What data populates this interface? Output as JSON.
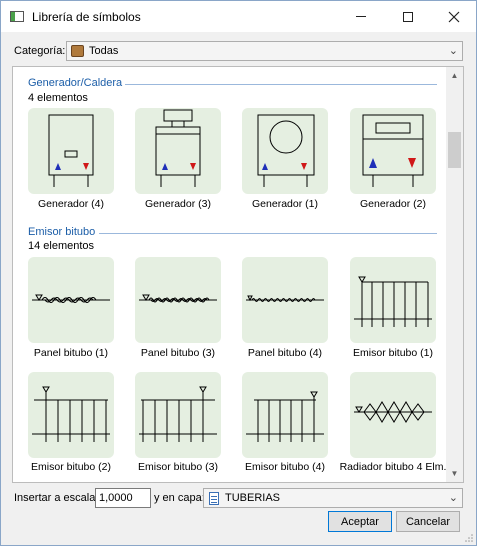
{
  "window": {
    "title": "Librería de símbolos"
  },
  "category": {
    "label": "Categoría:",
    "value": "Todas"
  },
  "sections": [
    {
      "title": "Generador/Caldera",
      "count": "4 elementos",
      "items": [
        {
          "label": "Generador (4)"
        },
        {
          "label": "Generador (3)"
        },
        {
          "label": "Generador (1)"
        },
        {
          "label": "Generador (2)"
        }
      ]
    },
    {
      "title": "Emisor bitubo",
      "count": "14 elementos",
      "items": [
        {
          "label": "Panel bitubo (1)"
        },
        {
          "label": "Panel bitubo (3)"
        },
        {
          "label": "Panel bitubo (4)"
        },
        {
          "label": "Emisor bitubo (1)"
        },
        {
          "label": "Emisor bitubo (2)"
        },
        {
          "label": "Emisor bitubo (3)"
        },
        {
          "label": "Emisor bitubo (4)"
        },
        {
          "label": "Radiador bitubo 4 Elm."
        }
      ]
    }
  ],
  "bottom": {
    "scale_label": "Insertar a escala:",
    "scale_value": "1,0000",
    "layer_label": "y en capa:",
    "layer_value": "TUBERIAS"
  },
  "buttons": {
    "accept": "Aceptar",
    "cancel": "Cancelar"
  },
  "colors": {
    "tile_bg": "#e5efe1",
    "section_title": "#1c5ea8",
    "arrow_blue": "#1f2fb8",
    "arrow_red": "#d01818"
  },
  "icons": {
    "app": "window-icon",
    "category": "box-icon",
    "layer": "layer-document-icon",
    "dropdown": "chevron-down-icon"
  }
}
